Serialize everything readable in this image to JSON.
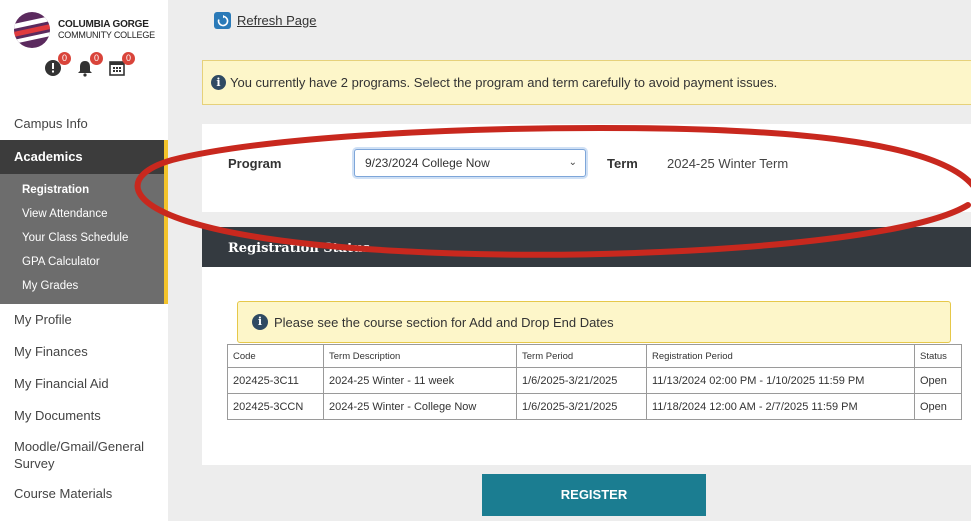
{
  "logo": {
    "line1": "COLUMBIA GORGE",
    "line2": "COMMUNITY COLLEGE"
  },
  "alerts": [
    {
      "icon": "exclamation-icon",
      "count": "0"
    },
    {
      "icon": "bell-icon",
      "count": "0"
    },
    {
      "icon": "calendar-icon",
      "count": "0"
    }
  ],
  "sidebar": {
    "campus_info": "Campus Info",
    "academics": "Academics",
    "academics_items": [
      "Registration",
      "View Attendance",
      "Your Class Schedule",
      "GPA Calculator",
      "My Grades"
    ],
    "my_profile": "My Profile",
    "my_finances": "My Finances",
    "my_financial_aid": "My Financial Aid",
    "my_documents": "My Documents",
    "moodle": "Moodle/Gmail/General Survey",
    "course_materials": "Course Materials"
  },
  "refresh": {
    "label": "Refresh Page"
  },
  "banner": {
    "text": "You currently have 2 programs. Select the program and term carefully to avoid payment issues."
  },
  "program": {
    "label": "Program",
    "selected": "9/23/2024 College Now",
    "term_label": "Term",
    "term_value": "2024-25 Winter Term"
  },
  "registration": {
    "header": "Registration Status",
    "notice": "Please see the course section for Add and Drop End Dates",
    "columns": [
      "Code",
      "Term Description",
      "Term Period",
      "Registration Period",
      "Status"
    ],
    "rows": [
      [
        "202425-3C11",
        "2024-25 Winter - 11 week",
        "1/6/2025-3/21/2025",
        "11/13/2024 02:00 PM - 1/10/2025 11:59 PM",
        "Open"
      ],
      [
        "202425-3CCN",
        "2024-25 Winter - College Now",
        "1/6/2025-3/21/2025",
        "11/18/2024 12:00 AM - 2/7/2025 11:59 PM",
        "Open"
      ]
    ]
  },
  "register_button": "REGISTER",
  "colors": {
    "sidebar_active": "#3c3c3c",
    "accent_yellow": "#f3c32b",
    "header_dark": "#343a40",
    "button_teal": "#1b7d91",
    "annotation_red": "#c8281e"
  }
}
